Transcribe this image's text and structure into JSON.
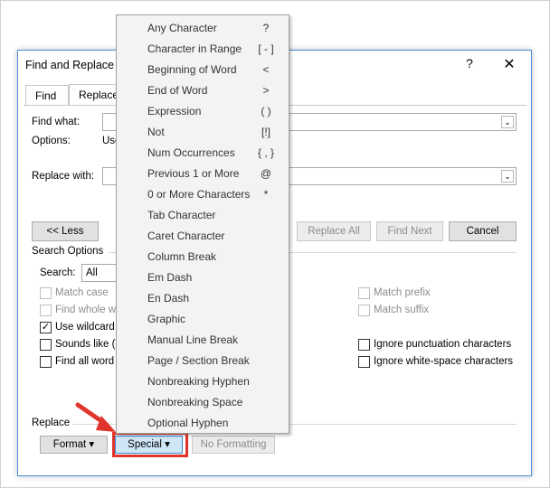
{
  "dialog": {
    "title": "Find and Replace",
    "help_icon": "help-icon",
    "close_icon": "close-icon",
    "tabs": [
      {
        "label": "Find"
      },
      {
        "label": "Replace"
      }
    ],
    "find_what_label": "Find what:",
    "options_label": "Options:",
    "options_value": "Use",
    "replace_with_label": "Replace with:",
    "less_button": "<< Less",
    "replace_all_button": "Replace All",
    "find_next_button": "Find Next",
    "cancel_button": "Cancel",
    "search_options_title": "Search Options",
    "search_label": "Search:",
    "search_value": "All",
    "left_options": [
      {
        "label": "Match case",
        "checked": false,
        "disabled": true
      },
      {
        "label": "Find whole w",
        "checked": false,
        "disabled": true
      },
      {
        "label": "Use wildcard",
        "checked": true,
        "disabled": false
      },
      {
        "label": "Sounds like (",
        "checked": false,
        "disabled": false
      },
      {
        "label": "Find all word",
        "checked": false,
        "disabled": false
      }
    ],
    "right_options": [
      {
        "label": "Match prefix",
        "checked": false,
        "disabled": true
      },
      {
        "label": "Match suffix",
        "checked": false,
        "disabled": true
      },
      {
        "label": "Ignore punctuation characters",
        "checked": false,
        "disabled": false
      },
      {
        "label": "Ignore white-space characters",
        "checked": false,
        "disabled": false
      }
    ],
    "replace_section_title": "Replace",
    "format_button": "Format ▾",
    "special_button": "Special ▾",
    "no_formatting_button": "No Formatting"
  },
  "special_menu": {
    "items": [
      {
        "label": "Any Character",
        "symbol": "?"
      },
      {
        "label": "Character in Range",
        "symbol": "[ - ]"
      },
      {
        "label": "Beginning of Word",
        "symbol": "<"
      },
      {
        "label": "End of Word",
        "symbol": ">"
      },
      {
        "label": "Expression",
        "symbol": "( )"
      },
      {
        "label": "Not",
        "symbol": "[!]"
      },
      {
        "label": "Num Occurrences",
        "symbol": "{ , }"
      },
      {
        "label": "Previous 1 or More",
        "symbol": "@"
      },
      {
        "label": "0 or More Characters",
        "symbol": "*"
      },
      {
        "label": "Tab Character",
        "symbol": ""
      },
      {
        "label": "Caret Character",
        "symbol": ""
      },
      {
        "label": "Column Break",
        "symbol": ""
      },
      {
        "label": "Em Dash",
        "symbol": ""
      },
      {
        "label": "En Dash",
        "symbol": ""
      },
      {
        "label": "Graphic",
        "symbol": ""
      },
      {
        "label": "Manual Line Break",
        "symbol": ""
      },
      {
        "label": "Page / Section Break",
        "symbol": ""
      },
      {
        "label": "Nonbreaking Hyphen",
        "symbol": ""
      },
      {
        "label": "Nonbreaking Space",
        "symbol": ""
      },
      {
        "label": "Optional Hyphen",
        "symbol": ""
      }
    ]
  },
  "colors": {
    "highlight_red": "#e0352b",
    "special_button_bg": "#cfe6f7",
    "dialog_border": "#4a90d9"
  }
}
